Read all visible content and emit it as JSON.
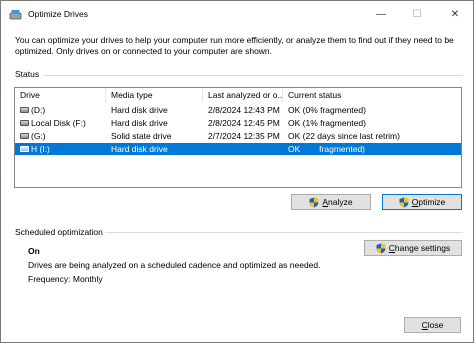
{
  "window": {
    "title": "Optimize Drives",
    "minimize_glyph": "—",
    "maximize_glyph": "☐",
    "close_glyph": "✕"
  },
  "description": "You can optimize your drives to help your computer run more efficiently, or analyze them to find out if they need to be optimized. Only drives on or connected to your computer are shown.",
  "status": {
    "label": "Status",
    "columns": [
      "Drive",
      "Media type",
      "Last analyzed or o...",
      "Current status"
    ],
    "rows": [
      {
        "drive": "(D:)",
        "media": "Hard disk drive",
        "last": "2/8/2024 12:43 PM",
        "status": "OK (0% fragmented)",
        "selected": false
      },
      {
        "drive": "Local Disk (F:)",
        "media": "Hard disk drive",
        "last": "2/8/2024 12:45 PM",
        "status": "OK (1% fragmented)",
        "selected": false
      },
      {
        "drive": "(G:)",
        "media": "Solid state drive",
        "last": "2/7/2024 12:35 PM",
        "status": "OK (22 days since last retrim)",
        "selected": false
      },
      {
        "drive": "H (I:)",
        "media": "Hard disk drive",
        "last": "",
        "status": "OK        fragmented)",
        "selected": true
      }
    ]
  },
  "buttons": {
    "analyze_first": "A",
    "analyze_rest": "nalyze",
    "optimize_first": "O",
    "optimize_rest": "ptimize",
    "change_settings_first": "C",
    "change_settings_rest": "hange settings",
    "close_first": "C",
    "close_rest": "lose"
  },
  "scheduled": {
    "label": "Scheduled optimization",
    "state": "On",
    "description": "Drives are being analyzed on a scheduled cadence and optimized as needed.",
    "frequency": "Frequency: Monthly"
  },
  "colors": {
    "selection": "#0078d7",
    "default_button_border": "#0078d7"
  }
}
